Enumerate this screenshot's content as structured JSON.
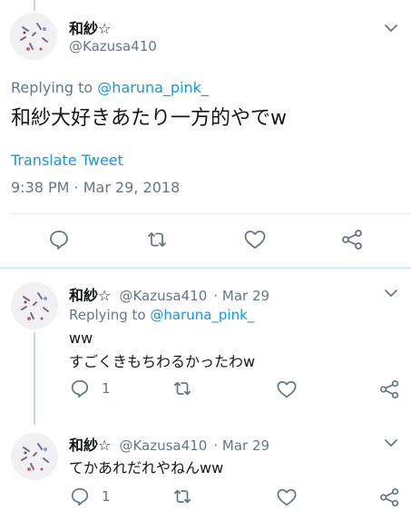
{
  "main_tweet": {
    "name": "和紗☆",
    "handle": "@Kazusa410",
    "replying_prefix": "Replying to ",
    "replying_to": "@haruna_pink_",
    "text": "和紗大好きあたり一方的やでw",
    "translate": "Translate Tweet",
    "timestamp": "9:38 PM · Mar 29, 2018"
  },
  "replies": [
    {
      "name": "和紗☆",
      "handle": "@Kazusa410",
      "date": "· Mar 29",
      "replying_prefix": "Replying to ",
      "replying_to": "@haruna_pink_",
      "line1": "ww",
      "line2": "すごくきもちわるかったわw",
      "reply_count": "1"
    },
    {
      "name": "和紗☆",
      "handle": "@Kazusa410",
      "date": "· Mar 29",
      "text": "てかあれだれやねんww",
      "reply_count": "1"
    }
  ],
  "colors": {
    "link": "#1b95e0",
    "muted": "#657786",
    "divider": "#e6ecf0"
  },
  "icons": [
    "reply-icon",
    "retweet-icon",
    "like-icon",
    "share-icon",
    "chevron-down-icon"
  ]
}
